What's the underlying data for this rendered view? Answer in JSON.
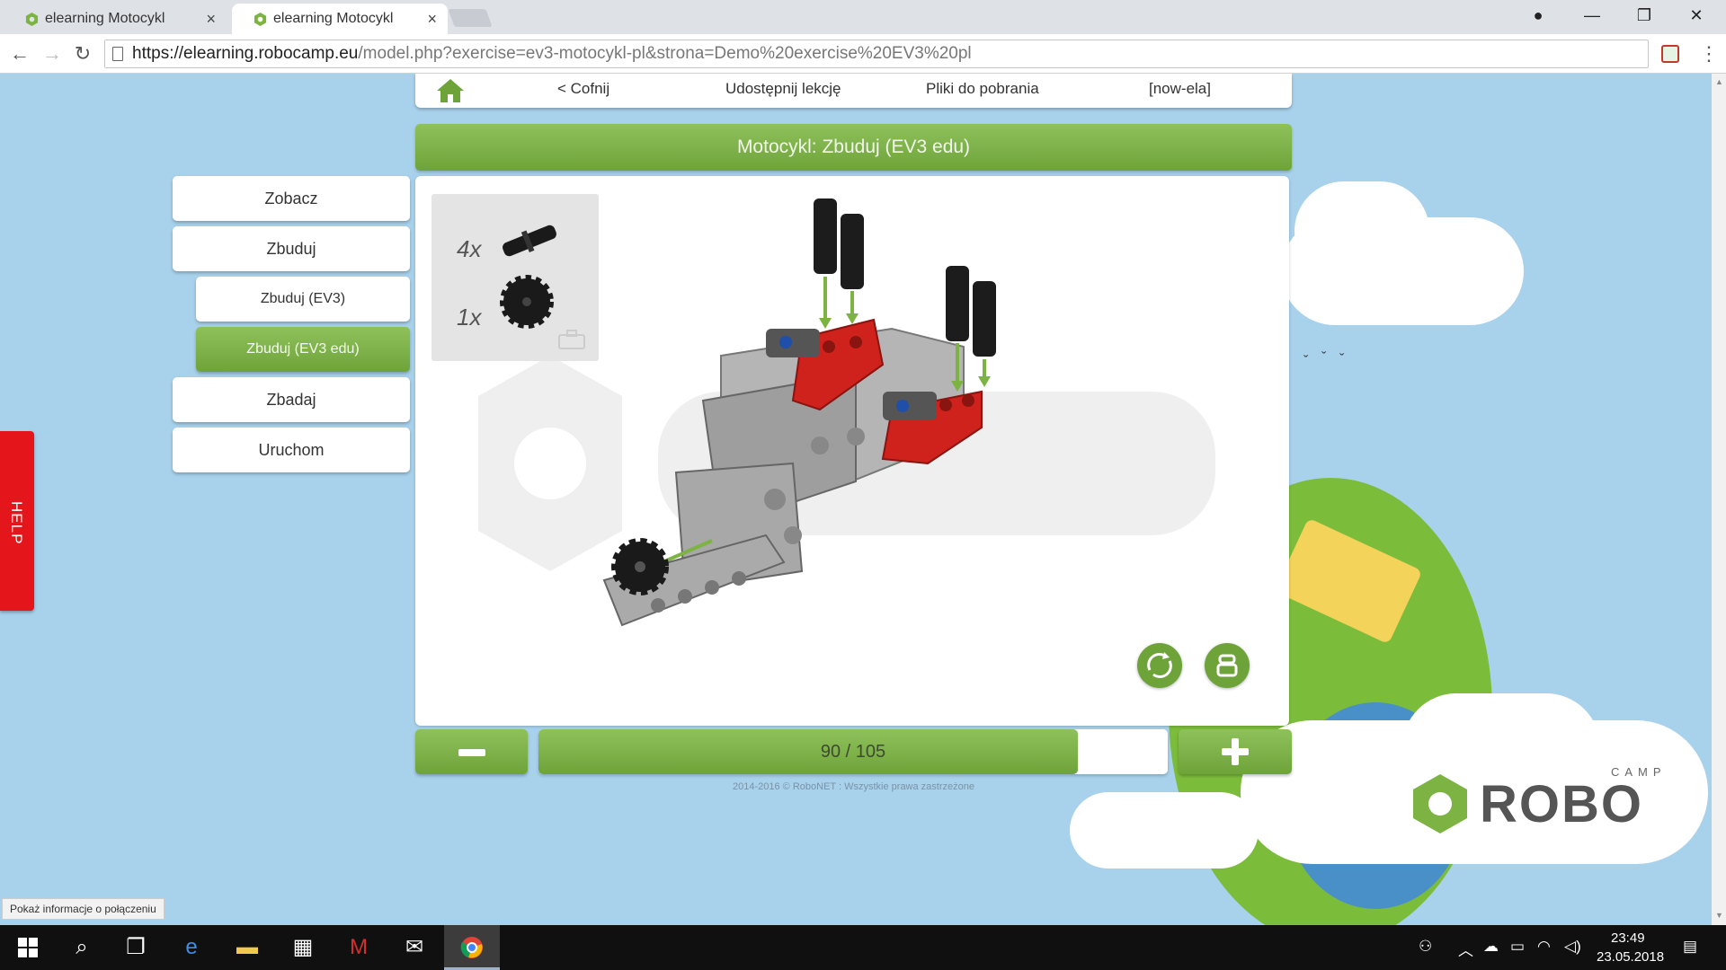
{
  "browser": {
    "tabs": [
      {
        "title": "elearning Motocykl",
        "active": false
      },
      {
        "title": "elearning Motocykl",
        "active": true
      }
    ],
    "close_glyph": "×",
    "url_host": "https://elearning.robocamp.eu",
    "url_rest": "/model.php?exercise=ev3-motocykl-pl&strona=Demo%20exercise%20EV3%20pl",
    "window_controls": {
      "account": "●",
      "minimize": "—",
      "restore": "❐",
      "close": "✕"
    },
    "nav": {
      "back": "←",
      "forward": "→",
      "reload": "↻"
    },
    "menu": "⋮"
  },
  "topnav": {
    "back": "< Cofnij",
    "share": "Udostępnij lekcję",
    "downloads": "Pliki do pobrania",
    "user": "[now-ela]"
  },
  "title": "Motocykl: Zbuduj (EV3 edu)",
  "sidebar": [
    {
      "label": "Zobacz",
      "level": "main",
      "active": false
    },
    {
      "label": "Zbuduj",
      "level": "main",
      "active": false
    },
    {
      "label": "Zbuduj (EV3)",
      "level": "sub",
      "active": false
    },
    {
      "label": "Zbuduj (EV3 edu)",
      "level": "sub",
      "active": true
    },
    {
      "label": "Zbadaj",
      "level": "main",
      "active": false
    },
    {
      "label": "Uruchom",
      "level": "main",
      "active": false
    }
  ],
  "help": "HELP",
  "parts": [
    {
      "qty": "4x",
      "part": "axle-pin-icon"
    },
    {
      "qty": "1x",
      "part": "gear-12-tooth-icon"
    }
  ],
  "step": {
    "current": 90,
    "total": 105,
    "label": "90 / 105",
    "progress": 0.8571
  },
  "footer": "2014-2016 © RoboNET : Wszystkie prawa zastrzeżone",
  "logo": {
    "word": "ROBO",
    "sub": "CAMP"
  },
  "status_bubble": "Pokaż informacje o połączeniu",
  "taskbar": {
    "time": "23:49",
    "date": "23.05.2018"
  },
  "colors": {
    "accent_green": "#6ea33a",
    "help_red": "#e4151b",
    "page_sky": "#a8d1eb"
  }
}
